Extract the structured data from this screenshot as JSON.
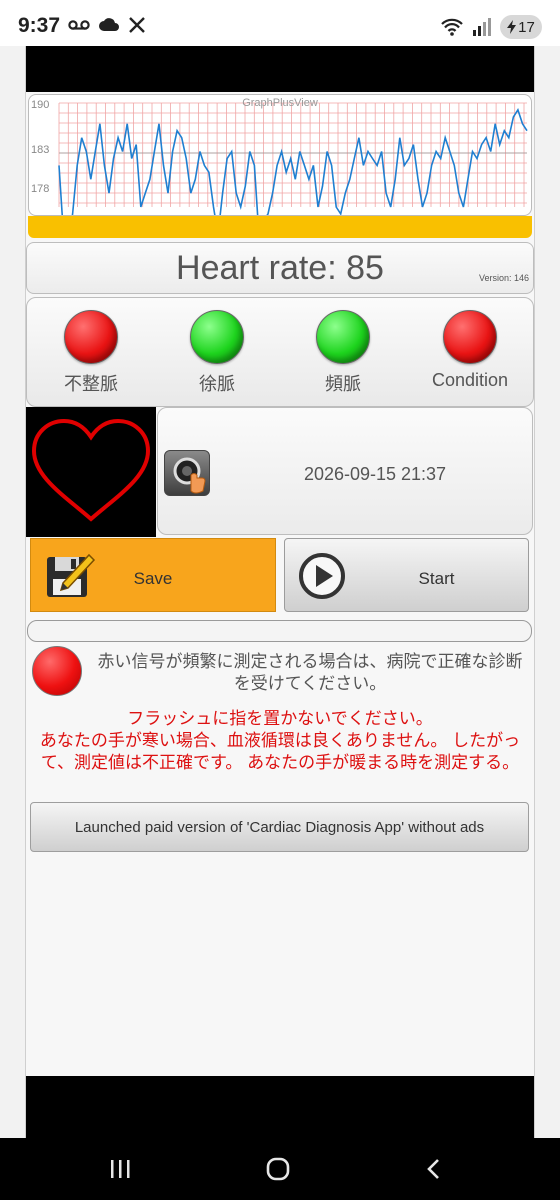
{
  "status_bar": {
    "time": "9:37",
    "left_icons": [
      "voicemail-icon",
      "cloud-icon",
      "x-logo-icon"
    ],
    "right_icons": [
      "wifi-icon",
      "signal-icon"
    ],
    "battery_level": "17"
  },
  "graph": {
    "label": "GraphPlusView",
    "y_labels": [
      "190",
      "183",
      "178"
    ],
    "chart_data": {
      "type": "line",
      "series": [
        {
          "values": [
            182,
            172,
            171,
            175,
            182,
            186,
            184,
            180,
            184,
            188,
            182,
            178,
            183,
            186,
            184,
            188,
            183,
            185,
            176,
            178,
            180,
            184,
            188,
            182,
            178,
            184,
            187,
            186,
            183,
            178,
            180,
            184,
            182,
            181,
            176,
            172,
            178,
            183,
            184,
            178,
            176,
            179,
            184,
            182,
            172,
            174,
            175,
            178,
            182,
            184,
            181,
            183,
            180,
            184,
            182,
            180,
            182,
            176,
            179,
            184,
            182,
            176,
            175,
            178,
            180,
            183,
            186,
            182,
            184,
            183,
            182,
            184,
            178,
            176,
            180,
            186,
            182,
            183,
            185,
            180,
            176,
            178,
            182,
            184,
            183,
            186,
            184,
            182,
            178,
            176,
            180,
            184,
            183,
            185,
            186,
            184,
            188,
            185,
            187,
            186,
            189,
            190,
            188,
            187
          ]
        }
      ],
      "ylim": [
        176,
        191
      ],
      "grid": true
    }
  },
  "heart_rate_text": "Heart rate: 85",
  "version_text": "Version: 146",
  "indicators": [
    {
      "label": "不整脈",
      "color": "#e91414"
    },
    {
      "label": "徐脈",
      "color": "#1ed41e"
    },
    {
      "label": "頻脈",
      "color": "#1ed41e"
    },
    {
      "label": "Condition",
      "color": "#e91414"
    }
  ],
  "datetime": "2026-09-15 21:37",
  "save_label": "Save",
  "start_label": "Start",
  "progress_value": 0,
  "warning_gray": "赤い信号が頻繁に測定される場合は、病院で正確な診断を受けてください。",
  "warning_red": "フラッシュに指を置かないでください。\nあなたの手が寒い場合、血液循環は良くありません。 したがって、測定値は不正確です。 あなたの手が暖まる時を測定する。",
  "paid_button": "Launched paid version of 'Cardiac Diagnosis App' without ads",
  "colors": {
    "accent_orange": "#f8a51c",
    "graph_yellow": "#f9c000",
    "warning_red": "#dd1111"
  }
}
